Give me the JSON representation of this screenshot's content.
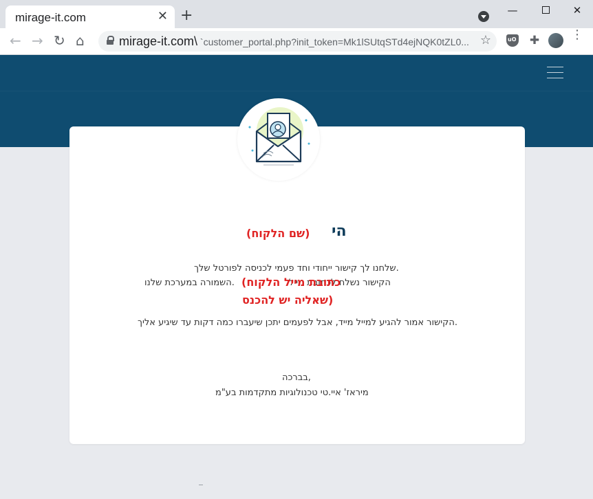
{
  "browser": {
    "tab_title": "mirage-it.com",
    "tab_close": "✕",
    "new_tab": "+",
    "window": {
      "minimize": "—",
      "close": "✕"
    },
    "nav": {
      "back": "←",
      "forward": "→",
      "reload": "↻",
      "home": "⌂"
    },
    "url_domain": "mirage-it.com\\",
    "url_path": " `customer_portal.php?init_token=Mk1lSUtqSTd4ejNQK0tZL0...",
    "bookmark_star": "☆",
    "puzzle": "✚",
    "menu_dots": "⋮"
  },
  "icons": {
    "header_menu": "hamburger-icon",
    "badge": "envelope-user-icon"
  },
  "colors": {
    "header": "#0f4c70",
    "placeholder_red": "#e02424",
    "heading": "#0f3c5a"
  },
  "content": {
    "greeting": "הי",
    "name_placeholder": "(שם הלקוח)",
    "line1": "שלחנו לך קישור ייחודי וחד פעמי לכניסה לפורטל שלך.",
    "line2_start": "הקישור נשלח לכתובת מייל",
    "line2_end": "השמורה במערכת שלנו.",
    "email_placeholder_1": "(כתובת מייל הלקוח",
    "email_placeholder_2": "שאליה יש להכנס)",
    "line3": "הקישור אמור להגיע למייל מייד, אבל לפעמים יתכן שיעברו כמה דקות עד שיגיע אליך.",
    "sign_1": "בברכה,",
    "sign_2": "מיראז' איי.טי טכנולוגיות מתקדמות בע\"מ"
  }
}
